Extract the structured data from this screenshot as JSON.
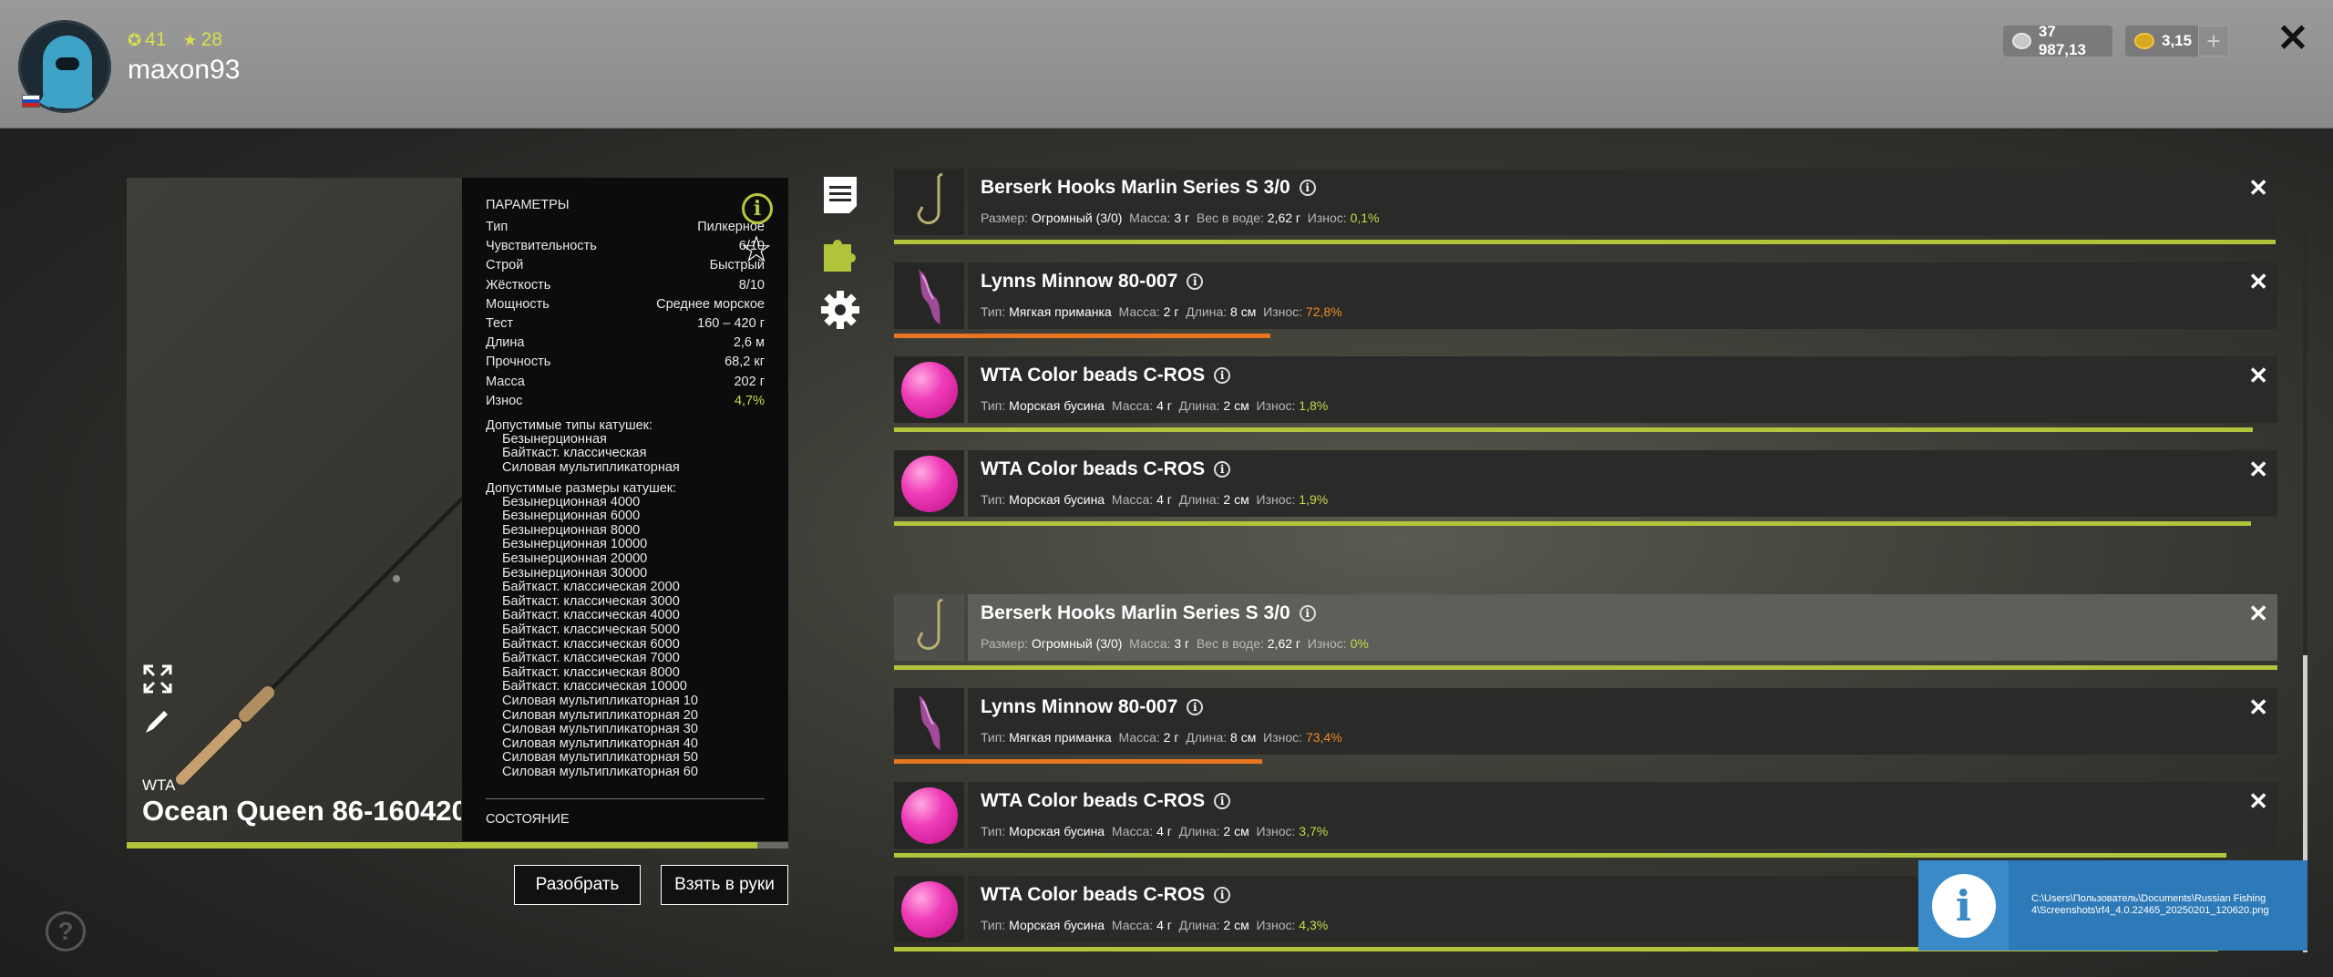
{
  "player": {
    "level": "41",
    "stars": "28",
    "username": "maxon93"
  },
  "currency": {
    "silver": "37 987,13",
    "gold": "3,15"
  },
  "rod": {
    "brand": "WTA",
    "name": "Ocean Queen 86-160420",
    "wear_fraction": 0.953,
    "params_title": "ПАРАМЕТРЫ",
    "params": [
      {
        "label": "Тип",
        "value": "Пилкерное"
      },
      {
        "label": "Чувствительность",
        "value": "6/10"
      },
      {
        "label": "Строй",
        "value": "Быстрый"
      },
      {
        "label": "Жёсткость",
        "value": "8/10"
      },
      {
        "label": "Мощность",
        "value": "Среднее морское"
      },
      {
        "label": "Тест",
        "value": "160 – 420 г"
      },
      {
        "label": "Длина",
        "value": "2,6 м"
      },
      {
        "label": "Прочность",
        "value": "68,2 кг"
      },
      {
        "label": "Масса",
        "value": "202 г"
      },
      {
        "label": "Износ",
        "value": "4,7%"
      }
    ],
    "reel_types_title": "Допустимые типы катушек:",
    "reel_types": [
      "Безынерционная",
      "Байткаст. классическая",
      "Силовая мультипликаторная"
    ],
    "reel_sizes_title": "Допустимые размеры катушек:",
    "reel_sizes": [
      "Безынерционная 4000",
      "Безынерционная 6000",
      "Безынерционная 8000",
      "Безынерционная 10000",
      "Безынерционная 20000",
      "Безынерционная 30000",
      "Байткаст. классическая 2000",
      "Байткаст. классическая 3000",
      "Байткаст. классическая 4000",
      "Байткаст. классическая 5000",
      "Байткаст. классическая 6000",
      "Байткаст. классическая 7000",
      "Байткаст. классическая 8000",
      "Байткаст. классическая 10000",
      "Силовая мультипликаторная 10",
      "Силовая мультипликаторная 20",
      "Силовая мультипликаторная 30",
      "Силовая мультипликаторная 40",
      "Силовая мультипликаторная 50",
      "Силовая мультипликаторная 60"
    ],
    "state_title": "СОСТОЯНИЕ"
  },
  "buttons": {
    "disassemble": "Разобрать",
    "take": "Взять в руки"
  },
  "labels": {
    "size": "Размер:",
    "mass": "Масса:",
    "water_weight": "Вес в воде:",
    "wear": "Износ:",
    "type": "Тип:",
    "length": "Длина:"
  },
  "tackle": [
    {
      "kind": "hook",
      "name": "Berserk Hooks Marlin Series S 3/0",
      "a": "Огромный (3/0)",
      "mass": "3 г",
      "extra": "2,62 г",
      "wear": "0,1%",
      "wear_color": "green",
      "condition": 0.999,
      "light": false
    },
    {
      "kind": "lure",
      "name": "Lynns Minnow 80-007",
      "a": "Мягкая приманка",
      "mass": "2 г",
      "extra": "8 см",
      "wear": "72,8%",
      "wear_color": "orange",
      "condition": 0.272,
      "light": false
    },
    {
      "kind": "bead",
      "name": "WTA Color beads C-ROS",
      "a": "Морская бусина",
      "mass": "4 г",
      "extra": "2 см",
      "wear": "1,8%",
      "wear_color": "green",
      "condition": 0.982,
      "light": false
    },
    {
      "kind": "bead",
      "name": "WTA Color beads C-ROS",
      "a": "Морская бусина",
      "mass": "4 г",
      "extra": "2 см",
      "wear": "1,9%",
      "wear_color": "green",
      "condition": 0.981,
      "light": false
    },
    {
      "kind": "hook",
      "name": "Berserk Hooks Marlin Series S 3/0",
      "a": "Огромный (3/0)",
      "mass": "3 г",
      "extra": "2,62 г",
      "wear": "0%",
      "wear_color": "green",
      "condition": 1.0,
      "light": true
    },
    {
      "kind": "lure",
      "name": "Lynns Minnow 80-007",
      "a": "Мягкая приманка",
      "mass": "2 г",
      "extra": "8 см",
      "wear": "73,4%",
      "wear_color": "orange",
      "condition": 0.266,
      "light": false
    },
    {
      "kind": "bead",
      "name": "WTA Color beads C-ROS",
      "a": "Морская бусина",
      "mass": "4 г",
      "extra": "2 см",
      "wear": "3,7%",
      "wear_color": "green",
      "condition": 0.963,
      "light": false
    },
    {
      "kind": "bead",
      "name": "WTA Color beads C-ROS",
      "a": "Морская бусина",
      "mass": "4 г",
      "extra": "2 см",
      "wear": "4,3%",
      "wear_color": "green",
      "condition": 0.957,
      "light": false
    }
  ],
  "notification": {
    "text": "C:\\Users\\Пользователь\\Documents\\Russian Fishing 4\\Screenshots\\rf4_4.0.22465_20250201_120620.png"
  },
  "colors": {
    "accent_green": "#b2c33c",
    "wear_orange": "#e8761c",
    "notification_blue": "#2e7ab8"
  }
}
